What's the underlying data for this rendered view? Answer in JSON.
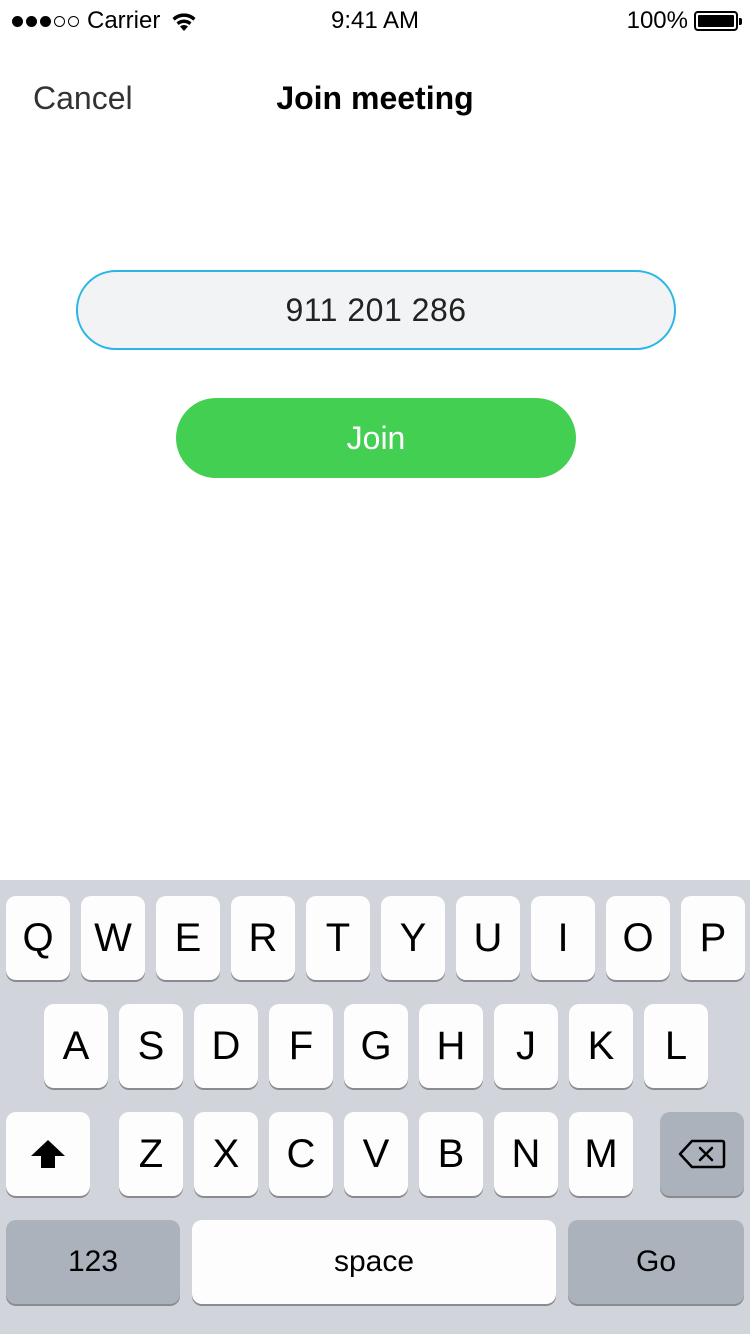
{
  "status_bar": {
    "carrier": "Carrier",
    "time": "9:41 AM",
    "battery_percent": "100%",
    "signal_bars_filled": 3,
    "signal_bars_total": 5,
    "battery_level": 1.0
  },
  "nav": {
    "cancel_label": "Cancel",
    "title": "Join meeting"
  },
  "meeting_id_field": {
    "value": "911 201 286"
  },
  "join_button": {
    "label": "Join"
  },
  "colors": {
    "field_border": "#29b6e6",
    "field_background": "#f2f3f5",
    "join_green": "#43cf52",
    "keyboard_background": "#d1d5db",
    "key_light": "#fdfdfe",
    "key_dark": "#abb2bc"
  },
  "keyboard": {
    "row1": [
      "Q",
      "W",
      "E",
      "R",
      "T",
      "Y",
      "U",
      "I",
      "O",
      "P"
    ],
    "row2": [
      "A",
      "S",
      "D",
      "F",
      "G",
      "H",
      "J",
      "K",
      "L"
    ],
    "row3": [
      "Z",
      "X",
      "C",
      "V",
      "B",
      "N",
      "M"
    ],
    "shift_icon": "shift-arrow-icon",
    "delete_icon": "backspace-icon",
    "numbers_label": "123",
    "space_label": "space",
    "go_label": "Go"
  }
}
